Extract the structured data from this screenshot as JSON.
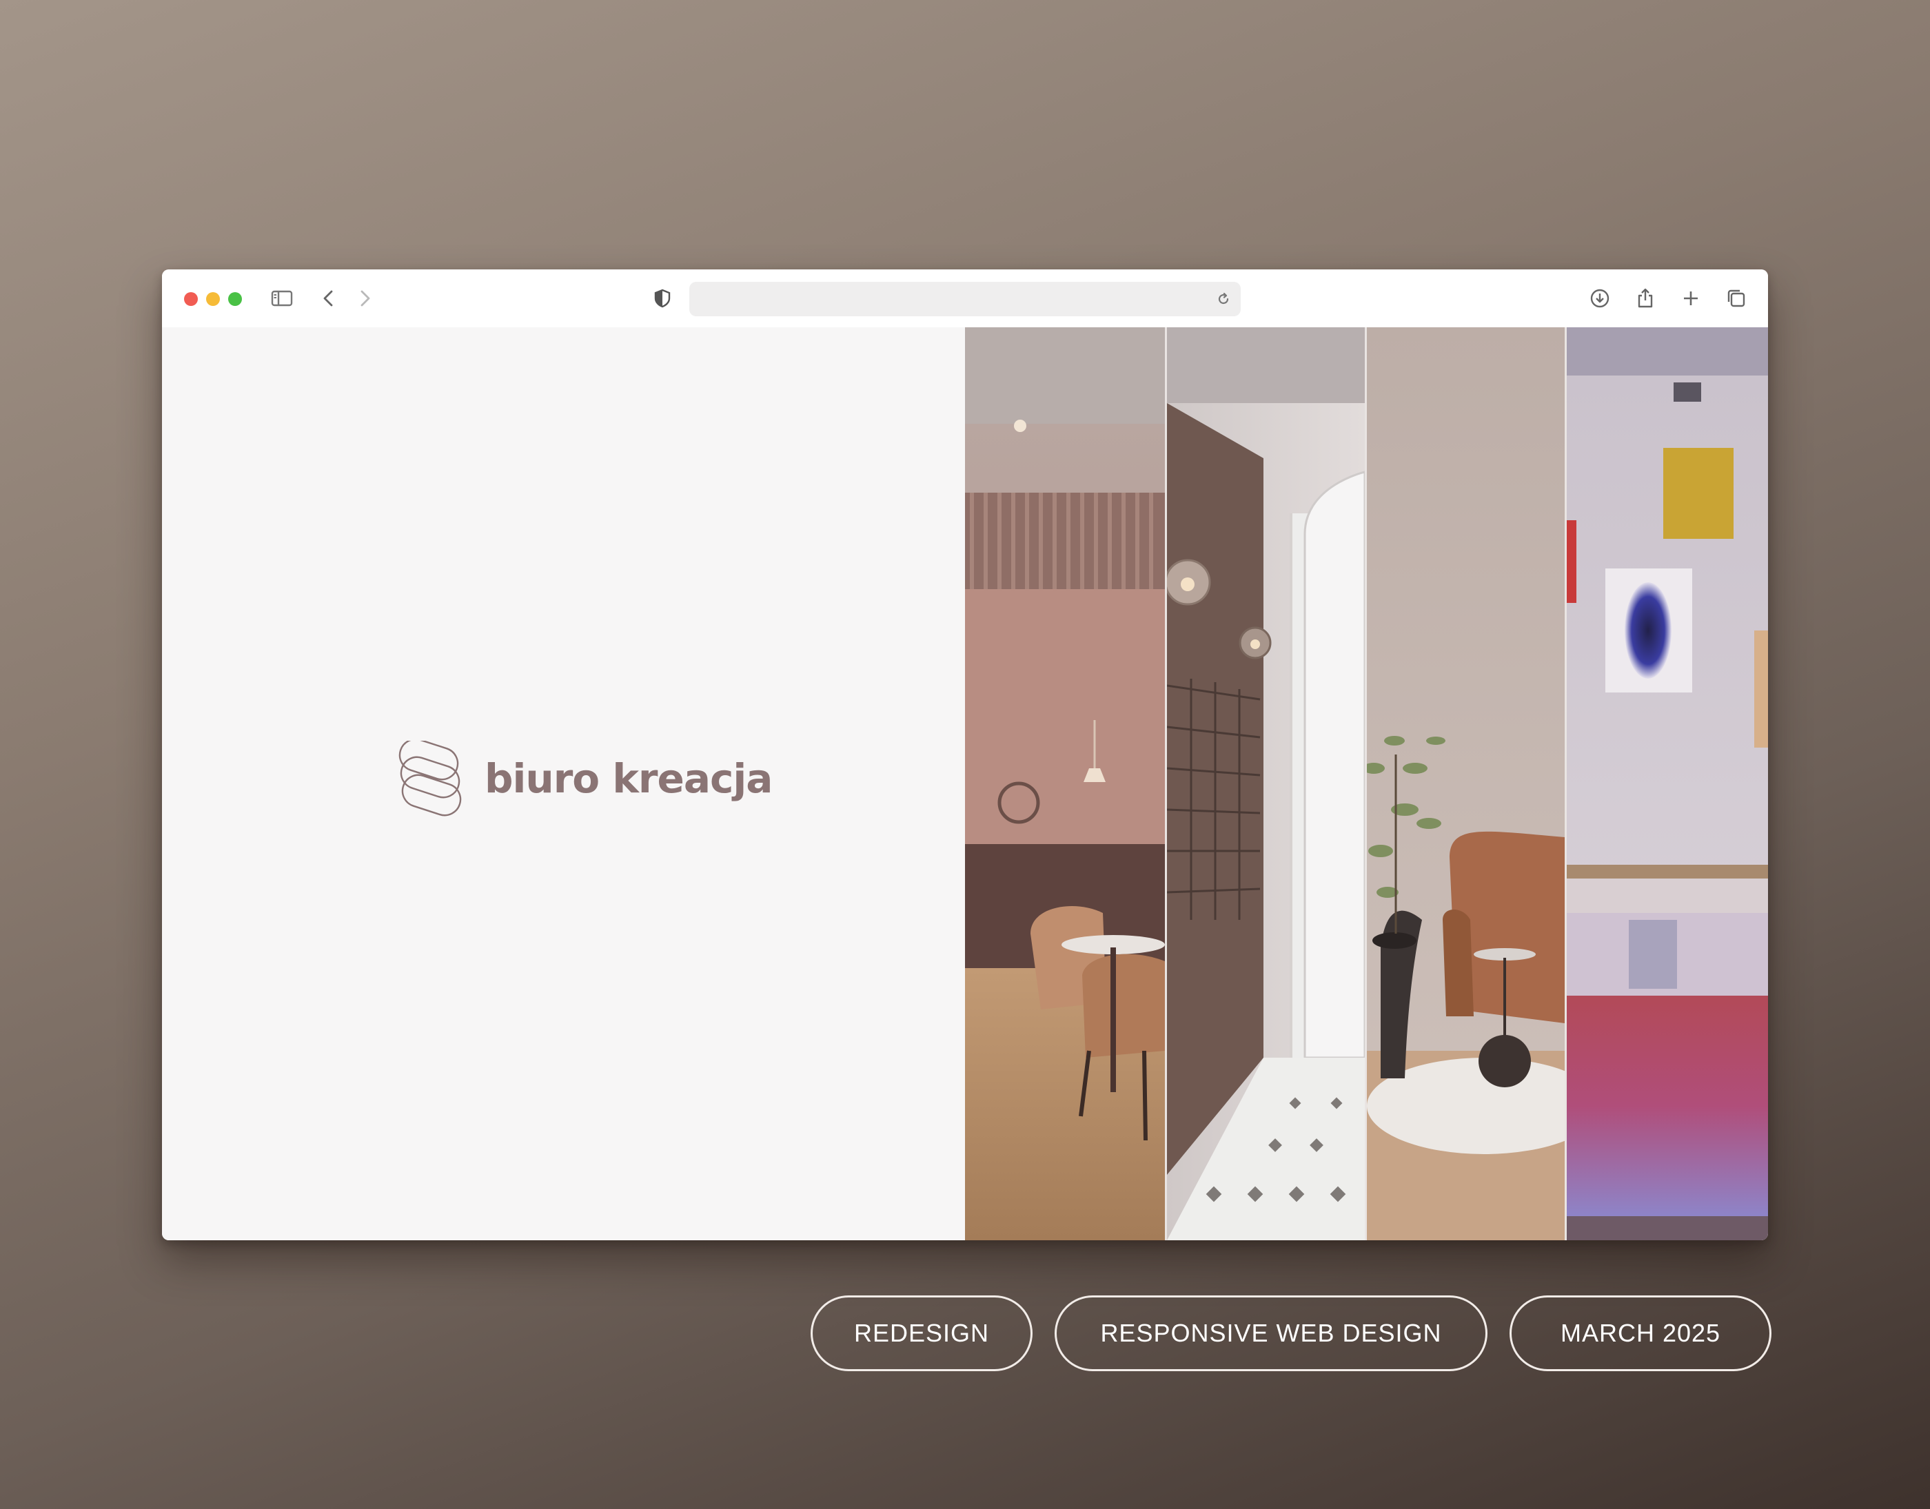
{
  "browser": {
    "address_text": "",
    "toolbar_icons": [
      "sidebar-icon",
      "back-icon",
      "forward-icon",
      "shield-icon",
      "reload-icon",
      "download-icon",
      "share-icon",
      "new-tab-icon",
      "tabs-overview-icon"
    ]
  },
  "page": {
    "logo_text": "biuro kreacja",
    "logo_color": "#8a7474",
    "gallery": [
      {
        "name": "cafe-interior"
      },
      {
        "name": "mailbox-hallway"
      },
      {
        "name": "lounge-armchair"
      },
      {
        "name": "art-gallery-reception"
      }
    ]
  },
  "tags": [
    {
      "label": "REDESIGN"
    },
    {
      "label": "RESPONSIVE WEB DESIGN"
    },
    {
      "label": "MARCH 2025"
    }
  ]
}
